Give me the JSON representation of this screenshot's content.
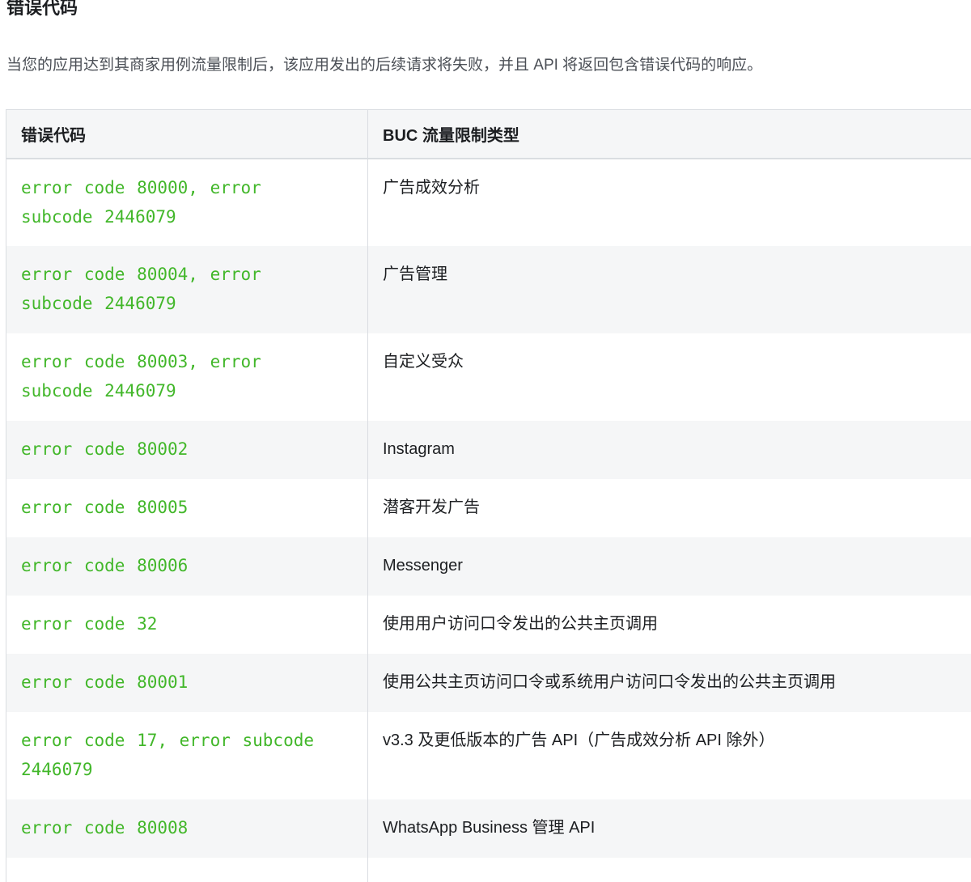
{
  "section_title": "错误代码",
  "intro": "当您的应用达到其商家用例流量限制后，该应用发出的后续请求将失败，并且 API 将返回包含错误代码的响应。",
  "table": {
    "headers": {
      "code": "错误代码",
      "type": "BUC 流量限制类型"
    },
    "rows": [
      {
        "code": "error code 80000, error subcode 2446079",
        "type": "广告成效分析"
      },
      {
        "code": "error code 80004, error subcode 2446079",
        "type": "广告管理"
      },
      {
        "code": "error code 80003, error subcode 2446079",
        "type": "自定义受众"
      },
      {
        "code": "error code 80002",
        "type": "Instagram"
      },
      {
        "code": "error code 80005",
        "type": "潜客开发广告"
      },
      {
        "code": "error code 80006",
        "type": "Messenger"
      },
      {
        "code": "error code 32",
        "type": "使用用户访问口令发出的公共主页调用"
      },
      {
        "code": "error code 80001",
        "type": "使用公共主页访问口令或系统用户访问口令发出的公共主页调用"
      },
      {
        "code": "error code 17, error subcode 2446079",
        "type": "v3.3 及更低版本的广告 API（广告成效分析 API 除外）"
      },
      {
        "code": "error code 80008",
        "type": "WhatsApp Business 管理 API"
      }
    ]
  },
  "colors": {
    "code_green": "#42b72a",
    "header_bg": "#f5f6f7",
    "alt_row_bg": "#f5f6f7",
    "border": "#dadde1",
    "text": "#1c1e21",
    "muted_text": "#4b4f56"
  }
}
